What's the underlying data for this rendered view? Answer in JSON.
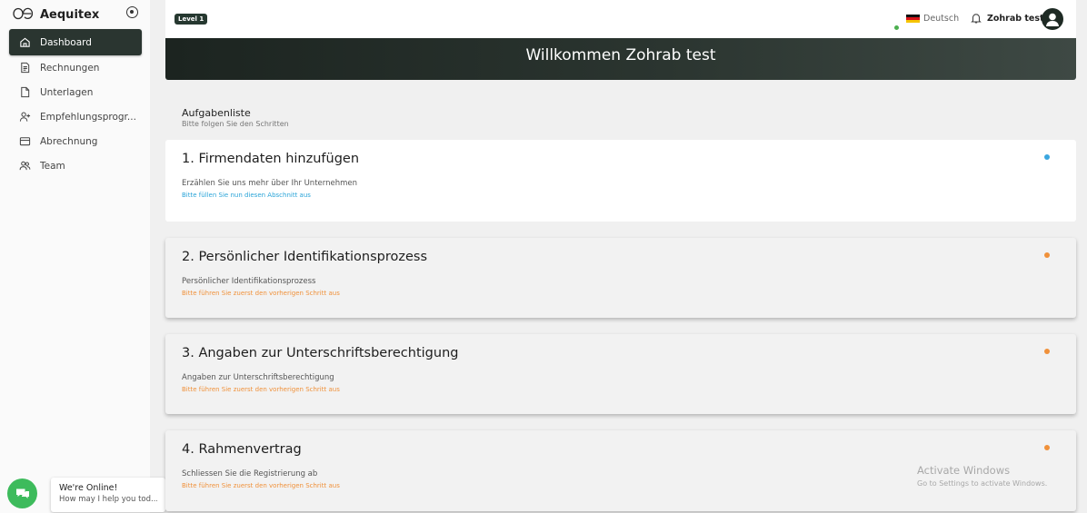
{
  "sidebar": {
    "brand": {
      "mark": "OE",
      "name": "Aequitex"
    },
    "items": [
      {
        "label": "Dashboard",
        "icon": "home-icon",
        "active": true
      },
      {
        "label": "Rechnungen",
        "icon": "invoice-icon"
      },
      {
        "label": "Unterlagen",
        "icon": "document-icon"
      },
      {
        "label": "Empfehlungsprogr...",
        "icon": "add-user-icon"
      },
      {
        "label": "Abrechnung",
        "icon": "card-icon"
      },
      {
        "label": "Team",
        "icon": "team-icon"
      }
    ]
  },
  "chat": {
    "title": "We're Online!",
    "subtitle": "How may I help you tod..."
  },
  "header": {
    "level": "Level 1",
    "language": "Deutsch",
    "username": "Zohrab test"
  },
  "banner": {
    "title": "Willkommen Zohrab test"
  },
  "tasks": {
    "title": "Aufgabenliste",
    "subtitle": "Bitte folgen Sie den Schritten",
    "items": [
      {
        "title": "1. Firmendaten hinzufügen",
        "description": "Erzählen Sie uns mehr über Ihr Unternehmen",
        "note": "Bitte füllen Sie nun diesen Abschnitt aus",
        "status": "active"
      },
      {
        "title": "2. Persönlicher Identifikationsprozess",
        "description": "Persönlicher Identifikationsprozess",
        "note": "Bitte führen Sie zuerst den vorherigen Schritt aus",
        "status": "locked"
      },
      {
        "title": "3. Angaben zur Unterschriftsberechtigung",
        "description": "Angaben zur Unterschriftsberechtigung",
        "note": "Bitte führen Sie zuerst den vorherigen Schritt aus",
        "status": "locked"
      },
      {
        "title": "4. Rahmenvertrag",
        "description": "Schliessen Sie die Registrierung ab",
        "note": "Bitte führen Sie zuerst den vorherigen Schritt aus",
        "status": "locked"
      }
    ]
  },
  "colors": {
    "active": "#3aa6df",
    "locked": "#f0913a",
    "brand_dark": "#263830"
  },
  "watermark": {
    "title": "Activate Windows",
    "subtitle": "Go to Settings to activate Windows."
  }
}
